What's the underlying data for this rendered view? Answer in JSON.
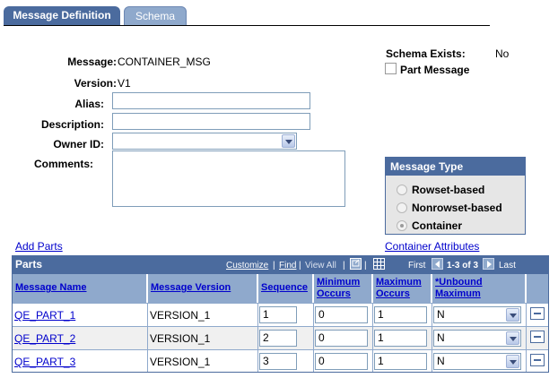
{
  "tabs": [
    {
      "label": "Message Definition",
      "active": true
    },
    {
      "label": "Schema",
      "active": false
    }
  ],
  "form": {
    "message_label": "Message:",
    "message_value": "CONTAINER_MSG",
    "version_label": "Version:",
    "version_value": "V1",
    "alias_label": "Alias:",
    "alias_value": "",
    "description_label": "Description:",
    "description_value": "",
    "owner_label": "Owner ID:",
    "owner_value": "",
    "comments_label": "Comments:",
    "comments_value": ""
  },
  "schema": {
    "exists_label": "Schema Exists:",
    "exists_value": "No",
    "part_message_label": "Part Message",
    "part_message_checked": false
  },
  "message_type": {
    "title": "Message Type",
    "options": [
      "Rowset-based",
      "Nonrowset-based",
      "Container"
    ],
    "selected": "Container"
  },
  "links": {
    "add_parts": "Add Parts",
    "container_attributes": "Container Attributes"
  },
  "grid": {
    "title": "Parts",
    "customize": "Customize",
    "find": "Find",
    "view_all": "View All",
    "first": "First",
    "range": "1-3 of 3",
    "last": "Last",
    "columns": [
      {
        "line1": "Message Name",
        "line2": ""
      },
      {
        "line1": "Message Version",
        "line2": ""
      },
      {
        "line1": "Sequence",
        "line2": ""
      },
      {
        "line1": "Minimum",
        "line2": "Occurs"
      },
      {
        "line1": "Maximum",
        "line2": "Occurs"
      },
      {
        "line1": "*Unbound",
        "line2": "Maximum"
      }
    ],
    "rows": [
      {
        "name": "QE_PART_1",
        "version": "VERSION_1",
        "sequence": "1",
        "min": "0",
        "max": "1",
        "unbound": "N"
      },
      {
        "name": "QE_PART_2",
        "version": "VERSION_1",
        "sequence": "2",
        "min": "0",
        "max": "1",
        "unbound": "N"
      },
      {
        "name": "QE_PART_3",
        "version": "VERSION_1",
        "sequence": "3",
        "min": "0",
        "max": "1",
        "unbound": "N"
      }
    ]
  },
  "colors": {
    "header_dark": "#4b6b9e",
    "header_light": "#8fa9cc",
    "link": "#0000cc"
  }
}
